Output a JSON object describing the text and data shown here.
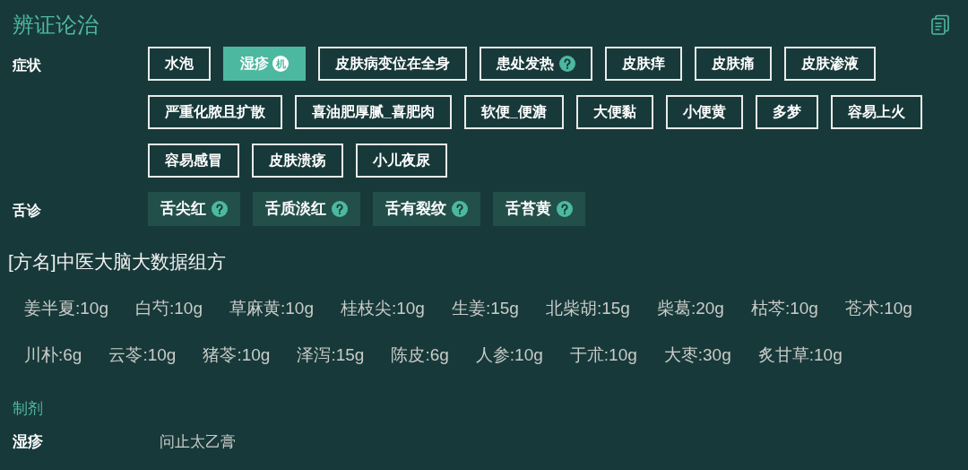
{
  "title": "辨证论治",
  "symptoms": {
    "label": "症状",
    "tags": [
      {
        "label": "水泡",
        "selected": false
      },
      {
        "label": "湿疹",
        "selected": true,
        "badge": "机"
      },
      {
        "label": "皮肤病变位在全身",
        "selected": false
      },
      {
        "label": "患处发热",
        "selected": false,
        "help": true
      },
      {
        "label": "皮肤痒",
        "selected": false
      },
      {
        "label": "皮肤痛",
        "selected": false
      },
      {
        "label": "皮肤渗液",
        "selected": false
      },
      {
        "label": "严重化脓且扩散",
        "selected": false
      },
      {
        "label": "喜油肥厚腻_喜肥肉",
        "selected": false
      },
      {
        "label": "软便_便溏",
        "selected": false
      },
      {
        "label": "大便黏",
        "selected": false
      },
      {
        "label": "小便黄",
        "selected": false
      },
      {
        "label": "多梦",
        "selected": false
      },
      {
        "label": "容易上火",
        "selected": false
      },
      {
        "label": "容易感冒",
        "selected": false
      },
      {
        "label": "皮肤溃疡",
        "selected": false
      },
      {
        "label": "小儿夜尿",
        "selected": false
      }
    ]
  },
  "tongue": {
    "label": "舌诊",
    "tags": [
      {
        "label": "舌尖红",
        "help": true
      },
      {
        "label": "舌质淡红",
        "help": true
      },
      {
        "label": "舌有裂纹",
        "help": true
      },
      {
        "label": "舌苔黄",
        "help": true
      }
    ]
  },
  "formula": {
    "name": "[方名]中医大脑大数据组方",
    "herb_rows": [
      [
        "姜半夏:10g",
        "白芍:10g",
        "草麻黄:10g",
        "桂枝尖:10g",
        "生姜:15g",
        "北柴胡:15g",
        "柴葛:20g",
        "枯芩:10g",
        "苍术:10g"
      ],
      [
        "川朴:6g",
        "云苓:10g",
        "猪苓:10g",
        "泽泻:15g",
        "陈皮:6g",
        "人参:10g",
        "于朮:10g",
        "大枣:30g",
        "炙甘草:10g"
      ]
    ]
  },
  "preparations": {
    "heading": "制剂",
    "rows": [
      {
        "condition": "湿疹",
        "product": "问止太乙膏"
      }
    ]
  }
}
